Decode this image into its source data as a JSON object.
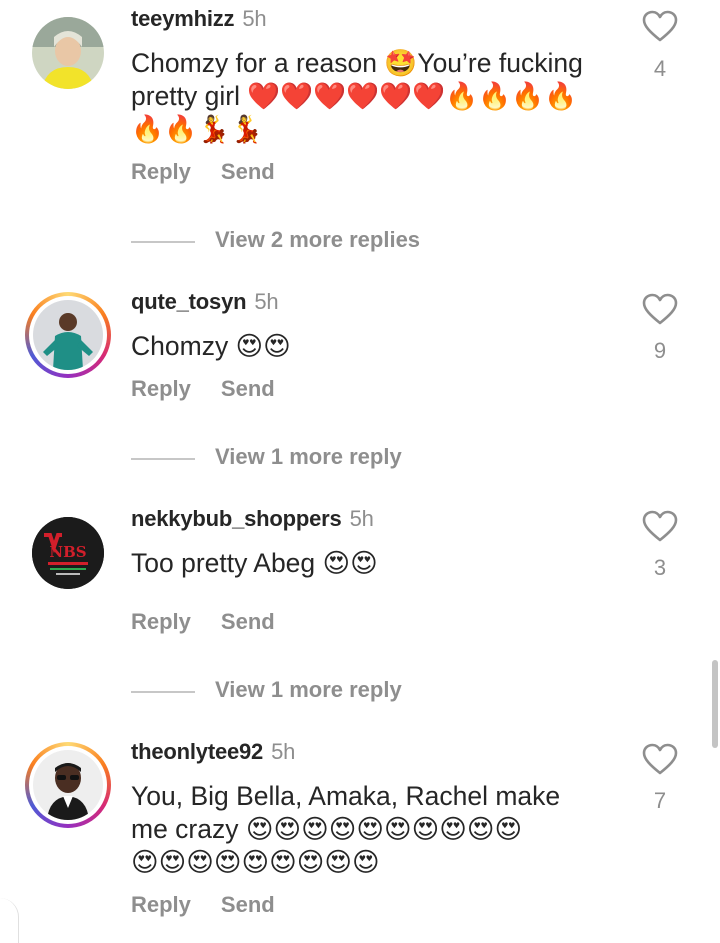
{
  "comments": [
    {
      "username": "teeymhizz",
      "time": "5h",
      "text_line1": "Chomzy for a reason 🤩You’re fucking",
      "text_line2": "pretty girl ❤️❤️❤️❤️❤️❤️🔥🔥🔥🔥",
      "text_line3": "🔥🔥💃💃",
      "reply_label": "Reply",
      "send_label": "Send",
      "likes": "4",
      "view_more": "View 2 more replies"
    },
    {
      "username": "qute_tosyn",
      "time": "5h",
      "text_line1": "Chomzy 😍😍",
      "reply_label": "Reply",
      "send_label": "Send",
      "likes": "9",
      "view_more": "View 1 more reply"
    },
    {
      "username": "nekkybub_shoppers",
      "time": "5h",
      "text_line1": "Too pretty Abeg 😍😍",
      "reply_label": "Reply",
      "send_label": "Send",
      "likes": "3",
      "view_more": "View 1 more reply",
      "avatar_logo": "NBS"
    },
    {
      "username": "theonlytee92",
      "time": "5h",
      "text_line1": "You, Big Bella, Amaka, Rachel make",
      "text_line2": "me crazy 😍😍😍😍😍😍😍😍😍😍",
      "text_line3": "😍😍😍😍😍😍😍😍😍",
      "reply_label": "Reply",
      "send_label": "Send",
      "likes": "7"
    }
  ],
  "icons": {
    "like": "heart-outline-icon"
  },
  "colors": {
    "secondary_text": "#8e8e8e",
    "primary_text": "#262626",
    "story_ring": "#d62976"
  }
}
